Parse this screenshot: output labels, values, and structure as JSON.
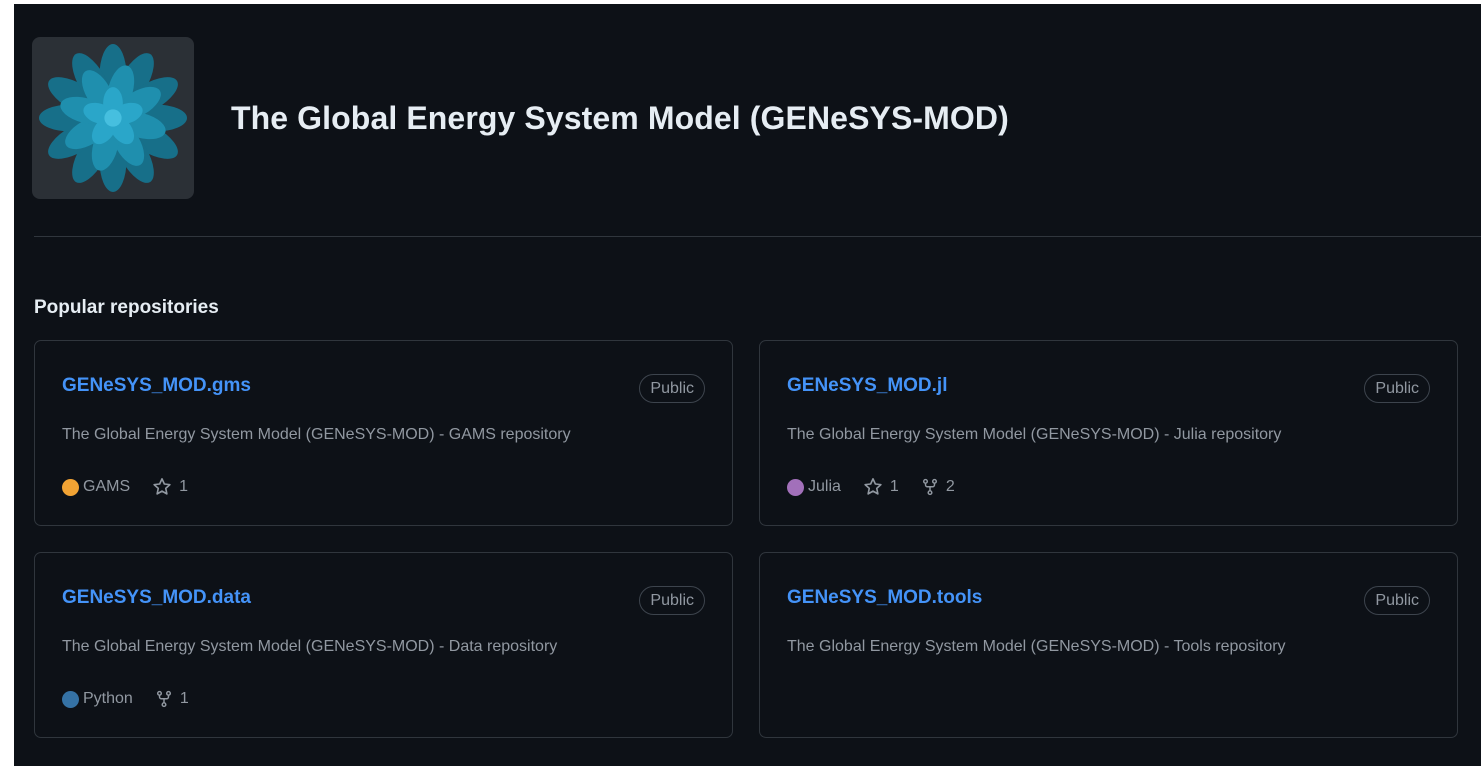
{
  "org": {
    "name": "The Global Energy System Model (GENeSYS-MOD)",
    "avatar_icon": "teal-flower-logo-icon"
  },
  "colors": {
    "background": "#0d1117",
    "border": "#30363d",
    "link": "#4493f8",
    "text_primary": "#e6edf3",
    "text_muted": "#9198a1",
    "avatar_flower": "#1f8fae"
  },
  "popular": {
    "title": "Popular repositories",
    "repos": [
      {
        "name": "GENeSYS_MOD.gms",
        "visibility": "Public",
        "description": "The Global Energy System Model (GENeSYS-MOD) - GAMS repository",
        "language": "GAMS",
        "language_color": "#f1a334",
        "stars": "1",
        "forks": ""
      },
      {
        "name": "GENeSYS_MOD.jl",
        "visibility": "Public",
        "description": "The Global Energy System Model (GENeSYS-MOD) - Julia repository",
        "language": "Julia",
        "language_color": "#a270ba",
        "stars": "1",
        "forks": "2"
      },
      {
        "name": "GENeSYS_MOD.data",
        "visibility": "Public",
        "description": "The Global Energy System Model (GENeSYS-MOD) - Data repository",
        "language": "Python",
        "language_color": "#3572a5",
        "stars": "",
        "forks": "1"
      },
      {
        "name": "GENeSYS_MOD.tools",
        "visibility": "Public",
        "description": "The Global Energy System Model (GENeSYS-MOD) - Tools repository",
        "language": "",
        "language_color": "",
        "stars": "",
        "forks": ""
      }
    ]
  }
}
